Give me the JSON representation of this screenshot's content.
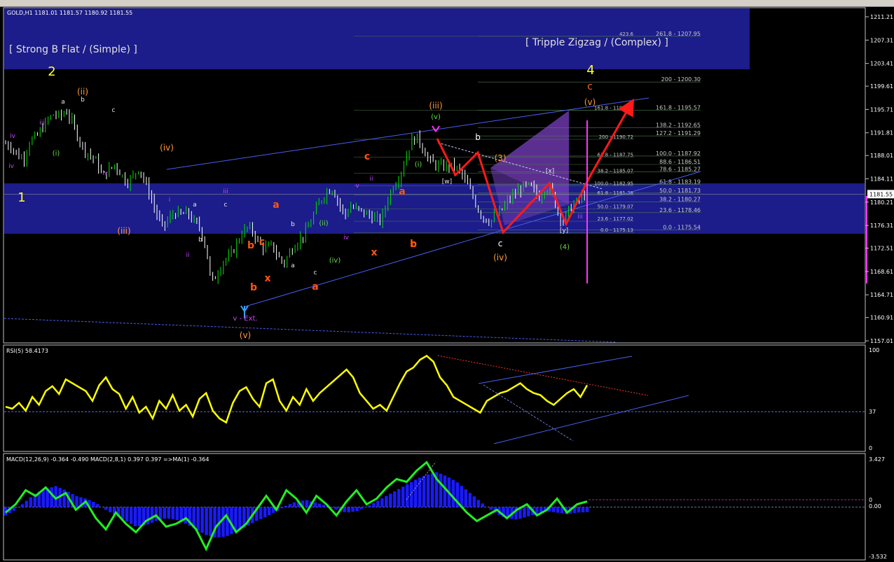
{
  "header": {
    "symbol_line": "GOLD,H1  1181.01 1181.57 1180.92 1181.55",
    "rsi_label": "RSI(5) 58.4173",
    "macd_label": "MACD(12,26,9) -0.364 -0.490  MACD(2,8,1) 0.397 0.397  =>MA(1) -0.364"
  },
  "annotations": {
    "pattern_left": "[ Strong B Flat / (Simple) ]",
    "pattern_right": "[ Tripple Zigzag / (Complex) ]",
    "vext": "v - Ext.",
    "current_price": "1181.55"
  },
  "colors": {
    "up_candle": "#00e000",
    "down_candle": "#ffffff",
    "zone": "#1c1c8a",
    "rsi": "#ffff00",
    "macd_hist": "#1a1aff",
    "macd_line": "#22ee22",
    "red_path": "#ff1a1a",
    "channel": "#4a5ef0"
  },
  "chart_data": [
    {
      "type": "line",
      "panel": "price",
      "ylim": [
        1157.01,
        1213.0
      ],
      "y_ticks": [
        "1211.21",
        "1207.31",
        "1203.41",
        "1199.61",
        "1195.71",
        "1191.81",
        "1188.01",
        "1184.11",
        "1180.21",
        "1176.31",
        "1172.51",
        "1168.61",
        "1164.71",
        "1160.91",
        "1157.01"
      ],
      "current_price": 1181.55,
      "series": [
        {
          "values": [
            1190.0,
            1189.5,
            1188.0,
            1187.5,
            1190.5,
            1191.0,
            1192.5,
            1194.0,
            1195.0,
            1194.5,
            1195.5,
            1193.5,
            1191.0,
            1189.0,
            1188.0,
            1187.0,
            1184.5,
            1185.5,
            1186.5,
            1185.0,
            1183.5,
            1184.5,
            1186.0,
            1183.5,
            1181.0,
            1178.0,
            1176.0,
            1177.5,
            1178.5,
            1178.0,
            1178.5,
            1177.0,
            1176.0,
            1173.0,
            1166.5,
            1168.5,
            1170.5,
            1171.0,
            1173.0,
            1175.0,
            1176.0,
            1175.0,
            1173.0,
            1172.5,
            1173.0,
            1171.0,
            1170.0,
            1172.0,
            1173.5,
            1174.5,
            1176.0,
            1178.5,
            1180.5,
            1182.0,
            1182.5,
            1180.0,
            1178.0,
            1179.5,
            1179.0,
            1178.5,
            1178.0,
            1177.5,
            1177.0,
            1180.5,
            1183.0,
            1184.5,
            1187.5,
            1190.5,
            1191.0,
            1189.0,
            1187.0,
            1186.5,
            1186.0,
            1186.5,
            1186.0,
            1185.5,
            1183.5,
            1181.5,
            1179.0,
            1177.5,
            1177.0,
            1178.0,
            1179.0,
            1180.5,
            1181.5,
            1182.5,
            1183.0,
            1182.5,
            1181.0,
            1182.5,
            1182.5,
            1179.0,
            1177.0,
            1179.0,
            1180.0,
            1181.0,
            1181.55
          ]
        }
      ]
    },
    {
      "type": "line",
      "panel": "rsi",
      "ylim": [
        0,
        100
      ],
      "y_ticks": [
        "100",
        "37",
        "0"
      ],
      "series": [
        {
          "values": [
            42,
            40,
            46,
            38,
            52,
            44,
            58,
            63,
            55,
            70,
            66,
            62,
            58,
            48,
            64,
            72,
            60,
            55,
            40,
            52,
            36,
            42,
            30,
            48,
            40,
            54,
            38,
            44,
            32,
            50,
            56,
            38,
            30,
            26,
            46,
            58,
            62,
            50,
            42,
            66,
            70,
            48,
            38,
            52,
            44,
            60,
            48,
            56,
            62,
            68,
            74,
            80,
            72,
            56,
            48,
            40,
            44,
            38,
            52,
            66,
            78,
            82,
            90,
            94,
            88,
            72,
            64,
            52,
            48,
            44,
            40,
            36,
            48,
            52,
            56,
            58,
            62,
            66,
            60,
            56,
            54,
            48,
            44,
            50,
            56,
            60,
            52,
            64
          ]
        }
      ]
    },
    {
      "type": "area",
      "panel": "macd",
      "ylim": [
        -3.532,
        3.427
      ],
      "y_ticks": [
        "3.427",
        "0",
        "0.00",
        "-3.532"
      ],
      "series": [
        {
          "name": "MACD(12,26,9)",
          "values": [
            -0.6,
            -0.2,
            0.4,
            1.0,
            1.3,
            1.5,
            1.2,
            0.8,
            0.6,
            0.3,
            -0.2,
            -0.6,
            -1.0,
            -1.4,
            -1.3,
            -1.0,
            -0.8,
            -0.9,
            -1.2,
            -1.6,
            -2.0,
            -2.2,
            -2.1,
            -1.8,
            -1.4,
            -1.0,
            -0.7,
            -0.3,
            0.1,
            0.4,
            0.5,
            0.3,
            0.1,
            -0.2,
            -0.4,
            -0.3,
            0.0,
            0.4,
            0.8,
            1.2,
            1.6,
            2.0,
            2.3,
            2.5,
            2.2,
            1.8,
            1.2,
            0.6,
            0.0,
            -0.5,
            -0.8,
            -0.9,
            -0.7,
            -0.5,
            -0.3,
            -0.4,
            -0.5,
            -0.4,
            -0.364
          ]
        },
        {
          "name": "MACD(2,8,1)",
          "values": [
            -0.4,
            0.2,
            1.2,
            0.8,
            1.4,
            0.6,
            1.0,
            -0.2,
            0.4,
            -0.8,
            -1.6,
            -0.4,
            -1.2,
            -1.8,
            -1.0,
            -0.6,
            -1.4,
            -1.2,
            -0.8,
            -1.6,
            -3.0,
            -1.4,
            -0.6,
            -1.8,
            -1.2,
            -0.2,
            0.8,
            -0.2,
            1.2,
            0.6,
            -0.4,
            0.8,
            0.2,
            -0.6,
            0.4,
            1.2,
            0.2,
            0.6,
            1.4,
            2.0,
            1.8,
            2.6,
            3.2,
            2.0,
            1.2,
            0.4,
            -0.4,
            -1.0,
            -0.6,
            -0.2,
            -0.8,
            -0.2,
            0.2,
            -0.6,
            -0.2,
            0.6,
            -0.4,
            0.2,
            0.397
          ]
        }
      ]
    }
  ],
  "waves_white": [
    "a",
    "b",
    "c",
    "a",
    "b",
    "c",
    "a",
    "b",
    "c",
    "[w]",
    "[x]",
    "[y]"
  ],
  "waves_orange": [
    "(ii)",
    "(iii)",
    "(iv)",
    "(v)",
    "(iv)",
    "(iii)",
    "(3)",
    "c",
    "(v)"
  ],
  "waves_yellow": [
    "1",
    "2",
    "4"
  ],
  "waves_red": [
    "a",
    "b",
    "c",
    "x",
    "a",
    "b",
    "c",
    "x",
    "a",
    "b",
    "c"
  ],
  "waves_green": [
    "(i)",
    "(ii)",
    "(iv)",
    "(v)",
    "(i)",
    "(4)"
  ],
  "waves_purple": [
    "iv",
    "iii",
    "iv",
    "i",
    "ii",
    "iii",
    "iv",
    "v",
    "ii",
    "iii",
    "iv"
  ],
  "fib_levels": [
    "261.8 - 1207.95",
    "200 - 1200.30",
    "161.8 - 1195.57",
    "138.2 - 1192.65",
    "127.2 - 1191.29",
    "100.0 - 1187.92",
    "88.6 - 1186.51",
    "78.6 - 1185.27",
    "61.8 - 1183.19",
    "50.0 - 1181.73",
    "38.2 - 1180.27",
    "23.6 - 1178.46",
    "0.0 - 1175.54"
  ],
  "fib_levels_small": [
    "423.6",
    "161.8 - 1195.57",
    "200 - 1190.72",
    "61.8 - 1187.75",
    "38.2 - 1185.07",
    "100.0 - 1182.95",
    "61.8 - 1181.38",
    "50.0 - 1179.07",
    "23.6 - 1177.02",
    "0.0 - 1175.13"
  ]
}
